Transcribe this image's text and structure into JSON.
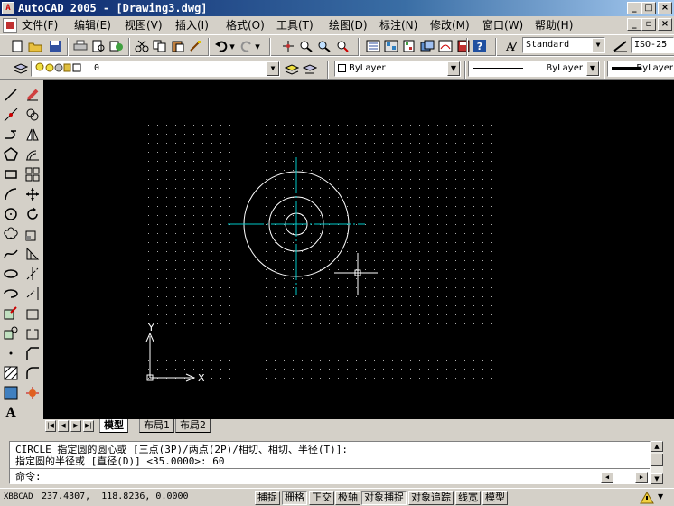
{
  "window": {
    "title": "AutoCAD 2005 - [Drawing3.dwg]"
  },
  "menu": [
    "文件(F)",
    "编辑(E)",
    "视图(V)",
    "插入(I)",
    "格式(O)",
    "工具(T)",
    "绘图(D)",
    "标注(N)",
    "修改(M)",
    "窗口(W)",
    "帮助(H)"
  ],
  "toolbar": {
    "text_style": "Standard",
    "dim_style": "ISO-25"
  },
  "layers": {
    "current_layer": "0",
    "color": "ByLayer",
    "linetype": "ByLayer",
    "lineweight": "ByLayer"
  },
  "canvas": {
    "ucs_y": "Y",
    "ucs_x": "X",
    "circles_radius": [
      12,
      30,
      58
    ],
    "colors": {
      "background": "#000000",
      "grid": "#b0b0b0",
      "entities": "#ffffff",
      "centerlines": "#00c8c8",
      "ucs": "#ffffff"
    }
  },
  "layout_tabs": [
    "模型",
    "布局1",
    "布局2"
  ],
  "command": {
    "line1": "CIRCLE 指定圆的圆心或 [三点(3P)/两点(2P)/相切、相切、半径(T)]:",
    "line2": "指定圆的半径或 [直径(D)] <35.0000>: 60",
    "prompt": "命令:"
  },
  "status": {
    "coords": "237.4307,  118.8236, 0.0000",
    "buttons": [
      "捕捉",
      "栅格",
      "正交",
      "极轴",
      "对象捕捉",
      "对象追踪",
      "线宽",
      "模型"
    ]
  }
}
